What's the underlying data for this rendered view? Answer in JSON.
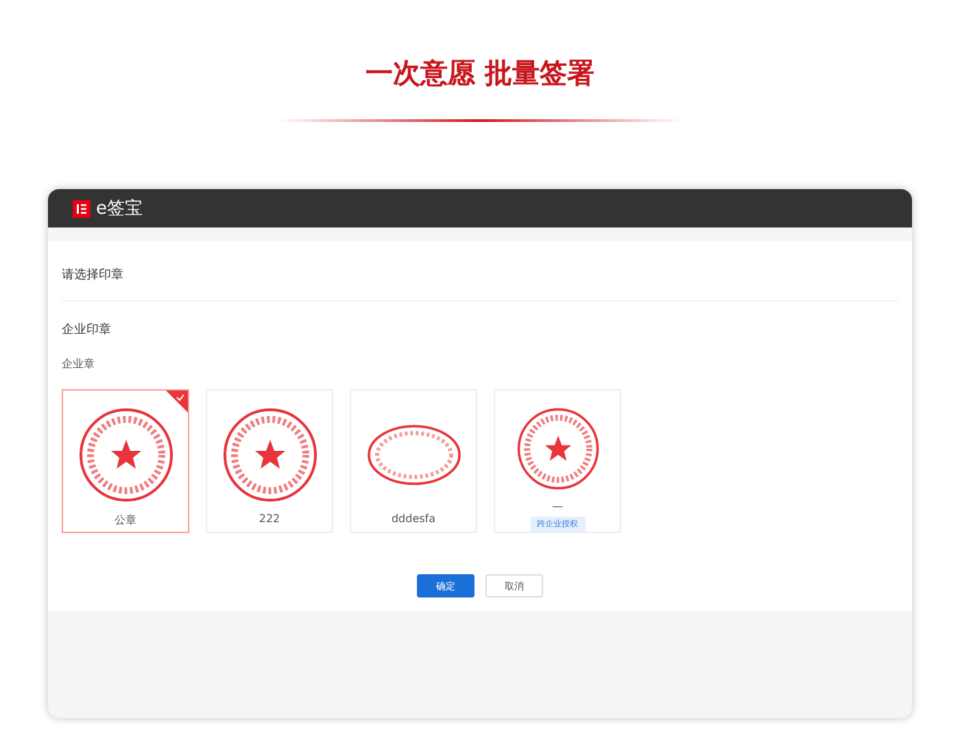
{
  "headline": "一次意愿 批量签署",
  "window": {
    "logo_text": "e签宝"
  },
  "dialog": {
    "title": "请选择印章",
    "section": "企业印章",
    "group": "企业章",
    "seals": [
      {
        "kind": "round",
        "label": "公章",
        "selected": true
      },
      {
        "kind": "round",
        "label": "222",
        "selected": false
      },
      {
        "kind": "oval",
        "label": "dddesfa",
        "selected": false
      },
      {
        "kind": "round",
        "label": "—",
        "badge": "跨企业授权",
        "selected": false
      }
    ],
    "buttons": [
      {
        "label": "确定",
        "kind": "primary"
      },
      {
        "label": "取消",
        "kind": "plain"
      }
    ]
  }
}
